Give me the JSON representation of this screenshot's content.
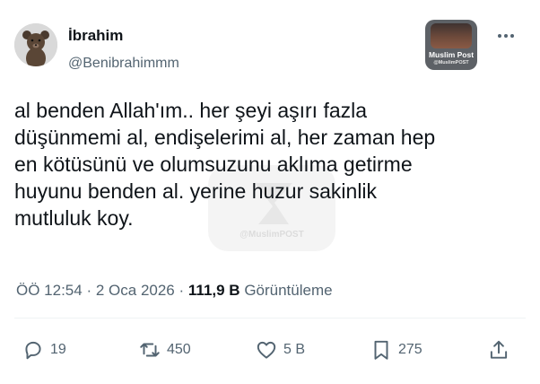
{
  "author": {
    "display_name": "İbrahim",
    "handle": "@Benibrahimmm"
  },
  "badge": {
    "title": "Muslim Post",
    "subtitle": "@MuslimPOST"
  },
  "watermark": {
    "text": "@MuslimPOST"
  },
  "tweet": {
    "lines": [
      "al benden Allah'ım.. her şeyi aşırı fazla",
      "düşünmemi al, endişelerimi al, her zaman hep",
      "en kötüsünü ve olumsuzunu aklıma getirme",
      "huyunu benden al. yerine huzur sakinlik",
      "mutluluk koy."
    ]
  },
  "meta": {
    "time": "ÖÖ 12:54",
    "separator": "·",
    "date": "2 Oca 2026",
    "views_count": "111,9 B",
    "views_label": "Görüntüleme"
  },
  "actions": {
    "replies": "19",
    "reposts": "450",
    "likes": "5 B",
    "bookmarks": "275"
  },
  "colors": {
    "text": "#0f1419",
    "secondary": "#536471",
    "divider": "#eff3f4",
    "badge_bg": "#5d6166"
  }
}
